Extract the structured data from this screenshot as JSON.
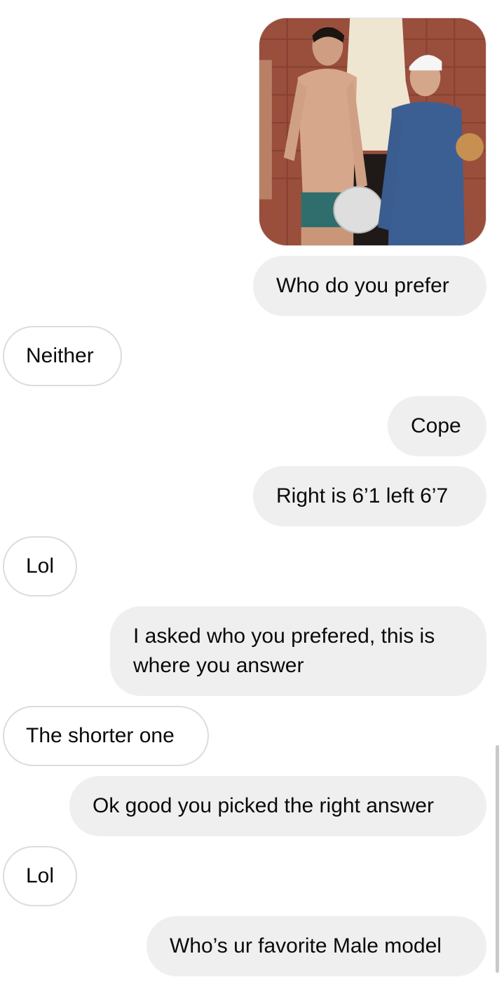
{
  "shared_photo": {
    "alt_icon": "photo-image"
  },
  "messages": [
    {
      "id": "m1",
      "direction": "sent",
      "text": "Who do you prefer"
    },
    {
      "id": "m2",
      "direction": "received",
      "text": "Neither"
    },
    {
      "id": "m3",
      "direction": "sent",
      "text": "Cope"
    },
    {
      "id": "m4",
      "direction": "sent",
      "text": "Right is 6’1 left 6’7"
    },
    {
      "id": "m5",
      "direction": "received",
      "text": "Lol"
    },
    {
      "id": "m6",
      "direction": "sent",
      "text": "I asked who you prefered, this is where you answer"
    },
    {
      "id": "m7",
      "direction": "received",
      "text": "The shorter one"
    },
    {
      "id": "m8",
      "direction": "sent",
      "text": "Ok good you picked the right answer"
    },
    {
      "id": "m9",
      "direction": "received",
      "text": "Lol"
    },
    {
      "id": "m10",
      "direction": "sent",
      "text": "Who’s ur favorite Male model"
    }
  ],
  "colors": {
    "sent_bubble": "#efefef",
    "received_bubble": "#ffffff",
    "received_border": "#dcdcdc",
    "text": "#0a0a0a"
  }
}
